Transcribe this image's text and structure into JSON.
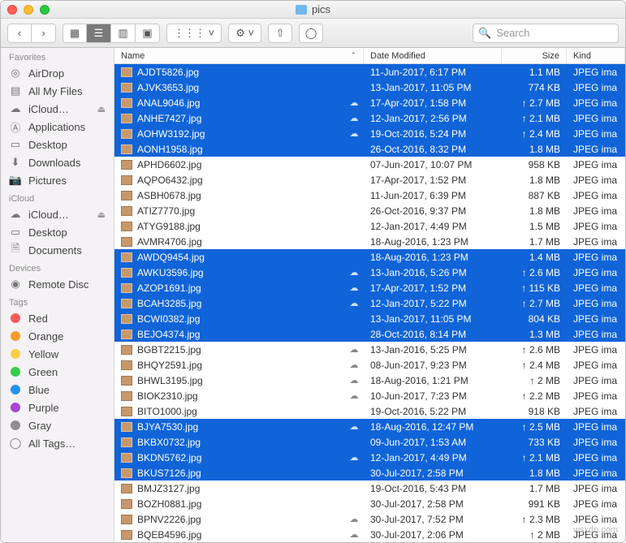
{
  "window": {
    "title": "pics"
  },
  "search": {
    "placeholder": "Search"
  },
  "sidebar": {
    "sections": [
      {
        "title": "Favorites",
        "items": [
          {
            "name": "airdrop",
            "label": "AirDrop",
            "icon": "◎"
          },
          {
            "name": "allmyfiles",
            "label": "All My Files",
            "icon": "▤"
          },
          {
            "name": "icloud-drive",
            "label": "iCloud…",
            "icon": "☁",
            "eject": true
          },
          {
            "name": "applications",
            "label": "Applications",
            "icon": "Ⓐ"
          },
          {
            "name": "desktop",
            "label": "Desktop",
            "icon": "▭"
          },
          {
            "name": "downloads",
            "label": "Downloads",
            "icon": "⬇"
          },
          {
            "name": "pictures",
            "label": "Pictures",
            "icon": "📷"
          }
        ]
      },
      {
        "title": "iCloud",
        "items": [
          {
            "name": "icloud-drive2",
            "label": "iCloud…",
            "icon": "☁",
            "eject": true
          },
          {
            "name": "desktop2",
            "label": "Desktop",
            "icon": "▭"
          },
          {
            "name": "documents",
            "label": "Documents",
            "icon": "🗎"
          }
        ]
      },
      {
        "title": "Devices",
        "items": [
          {
            "name": "remote-disc",
            "label": "Remote Disc",
            "icon": "◉"
          }
        ]
      },
      {
        "title": "Tags",
        "items": [
          {
            "name": "tag-red",
            "label": "Red",
            "color": "#fc5b57"
          },
          {
            "name": "tag-orange",
            "label": "Orange",
            "color": "#fd9a27"
          },
          {
            "name": "tag-yellow",
            "label": "Yellow",
            "color": "#fdcd46"
          },
          {
            "name": "tag-green",
            "label": "Green",
            "color": "#37cc4b"
          },
          {
            "name": "tag-blue",
            "label": "Blue",
            "color": "#2094fa"
          },
          {
            "name": "tag-purple",
            "label": "Purple",
            "color": "#a846d6"
          },
          {
            "name": "tag-gray",
            "label": "Gray",
            "color": "#8e8e93"
          },
          {
            "name": "tag-all",
            "label": "All Tags…",
            "icon": "◯"
          }
        ]
      }
    ]
  },
  "columns": {
    "name": "Name",
    "date": "Date Modified",
    "size": "Size",
    "kind": "Kind"
  },
  "files": [
    {
      "sel": true,
      "cloud": false,
      "up": false,
      "name": "AJDT5826.jpg",
      "date": "11-Jun-2017, 6:17 PM",
      "size": "1.1 MB",
      "kind": "JPEG ima"
    },
    {
      "sel": true,
      "cloud": false,
      "up": false,
      "name": "AJVK3653.jpg",
      "date": "13-Jan-2017, 11:05 PM",
      "size": "774 KB",
      "kind": "JPEG ima"
    },
    {
      "sel": true,
      "cloud": true,
      "up": true,
      "name": "ANAL9046.jpg",
      "date": "17-Apr-2017, 1:58 PM",
      "size": "2.7 MB",
      "kind": "JPEG ima"
    },
    {
      "sel": true,
      "cloud": true,
      "up": true,
      "name": "ANHE7427.jpg",
      "date": "12-Jan-2017, 2:56 PM",
      "size": "2.1 MB",
      "kind": "JPEG ima"
    },
    {
      "sel": true,
      "cloud": true,
      "up": true,
      "name": "AOHW3192.jpg",
      "date": "19-Oct-2016, 5:24 PM",
      "size": "2.4 MB",
      "kind": "JPEG ima"
    },
    {
      "sel": true,
      "cloud": false,
      "up": false,
      "name": "AONH1958.jpg",
      "date": "26-Oct-2016, 8:32 PM",
      "size": "1.8 MB",
      "kind": "JPEG ima"
    },
    {
      "sel": false,
      "cloud": false,
      "up": false,
      "name": "APHD6602.jpg",
      "date": "07-Jun-2017, 10:07 PM",
      "size": "958 KB",
      "kind": "JPEG ima"
    },
    {
      "sel": false,
      "cloud": false,
      "up": false,
      "name": "AQPO6432.jpg",
      "date": "17-Apr-2017, 1:52 PM",
      "size": "1.8 MB",
      "kind": "JPEG ima"
    },
    {
      "sel": false,
      "cloud": false,
      "up": false,
      "name": "ASBH0678.jpg",
      "date": "11-Jun-2017, 6:39 PM",
      "size": "887 KB",
      "kind": "JPEG ima"
    },
    {
      "sel": false,
      "cloud": false,
      "up": false,
      "name": "ATIZ7770.jpg",
      "date": "26-Oct-2016, 9:37 PM",
      "size": "1.8 MB",
      "kind": "JPEG ima"
    },
    {
      "sel": false,
      "cloud": false,
      "up": false,
      "name": "ATYG9188.jpg",
      "date": "12-Jan-2017, 4:49 PM",
      "size": "1.5 MB",
      "kind": "JPEG ima"
    },
    {
      "sel": false,
      "cloud": false,
      "up": false,
      "name": "AVMR4706.jpg",
      "date": "18-Aug-2016, 1:23 PM",
      "size": "1.7 MB",
      "kind": "JPEG ima"
    },
    {
      "sel": true,
      "cloud": false,
      "up": false,
      "name": "AWDQ9454.jpg",
      "date": "18-Aug-2016, 1:23 PM",
      "size": "1.4 MB",
      "kind": "JPEG ima"
    },
    {
      "sel": true,
      "cloud": true,
      "up": true,
      "name": "AWKU3596.jpg",
      "date": "13-Jan-2016, 5:26 PM",
      "size": "2.6 MB",
      "kind": "JPEG ima"
    },
    {
      "sel": true,
      "cloud": true,
      "up": true,
      "name": "AZOP1691.jpg",
      "date": "17-Apr-2017, 1:52 PM",
      "size": "115 KB",
      "kind": "JPEG ima"
    },
    {
      "sel": true,
      "cloud": true,
      "up": true,
      "name": "BCAH3285.jpg",
      "date": "12-Jan-2017, 5:22 PM",
      "size": "2.7 MB",
      "kind": "JPEG ima"
    },
    {
      "sel": true,
      "cloud": false,
      "up": false,
      "name": "BCWI0382.jpg",
      "date": "13-Jan-2017, 11:05 PM",
      "size": "804 KB",
      "kind": "JPEG ima"
    },
    {
      "sel": true,
      "cloud": false,
      "up": false,
      "name": "BEJO4374.jpg",
      "date": "28-Oct-2016, 8:14 PM",
      "size": "1.3 MB",
      "kind": "JPEG ima"
    },
    {
      "sel": false,
      "cloud": true,
      "up": true,
      "name": "BGBT2215.jpg",
      "date": "13-Jan-2016, 5:25 PM",
      "size": "2.6 MB",
      "kind": "JPEG ima"
    },
    {
      "sel": false,
      "cloud": true,
      "up": true,
      "name": "BHQY2591.jpg",
      "date": "08-Jun-2017, 9:23 PM",
      "size": "2.4 MB",
      "kind": "JPEG ima"
    },
    {
      "sel": false,
      "cloud": true,
      "up": true,
      "name": "BHWL3195.jpg",
      "date": "18-Aug-2016, 1:21 PM",
      "size": "2 MB",
      "kind": "JPEG ima"
    },
    {
      "sel": false,
      "cloud": true,
      "up": true,
      "name": "BIOK2310.jpg",
      "date": "10-Jun-2017, 7:23 PM",
      "size": "2.2 MB",
      "kind": "JPEG ima"
    },
    {
      "sel": false,
      "cloud": false,
      "up": false,
      "name": "BITO1000.jpg",
      "date": "19-Oct-2016, 5:22 PM",
      "size": "918 KB",
      "kind": "JPEG ima"
    },
    {
      "sel": true,
      "cloud": true,
      "up": true,
      "name": "BJYA7530.jpg",
      "date": "18-Aug-2016, 12:47 PM",
      "size": "2.5 MB",
      "kind": "JPEG ima"
    },
    {
      "sel": true,
      "cloud": false,
      "up": false,
      "name": "BKBX0732.jpg",
      "date": "09-Jun-2017, 1:53 AM",
      "size": "733 KB",
      "kind": "JPEG ima"
    },
    {
      "sel": true,
      "cloud": true,
      "up": true,
      "name": "BKDN5762.jpg",
      "date": "12-Jan-2017, 4:49 PM",
      "size": "2.1 MB",
      "kind": "JPEG ima"
    },
    {
      "sel": true,
      "cloud": false,
      "up": false,
      "name": "BKUS7126.jpg",
      "date": "30-Jul-2017, 2:58 PM",
      "size": "1.8 MB",
      "kind": "JPEG ima"
    },
    {
      "sel": false,
      "cloud": false,
      "up": false,
      "name": "BMJZ3127.jpg",
      "date": "19-Oct-2016, 5:43 PM",
      "size": "1.7 MB",
      "kind": "JPEG ima"
    },
    {
      "sel": false,
      "cloud": false,
      "up": false,
      "name": "BOZH0881.jpg",
      "date": "30-Jul-2017, 2:58 PM",
      "size": "991 KB",
      "kind": "JPEG ima"
    },
    {
      "sel": false,
      "cloud": true,
      "up": true,
      "name": "BPNV2226.jpg",
      "date": "30-Jul-2017, 7:52 PM",
      "size": "2.3 MB",
      "kind": "JPEG ima"
    },
    {
      "sel": false,
      "cloud": true,
      "up": true,
      "name": "BQEB4596.jpg",
      "date": "30-Jul-2017, 2:06 PM",
      "size": "2 MB",
      "kind": "JPEG ima"
    }
  ],
  "watermark": "wsxdn.com"
}
